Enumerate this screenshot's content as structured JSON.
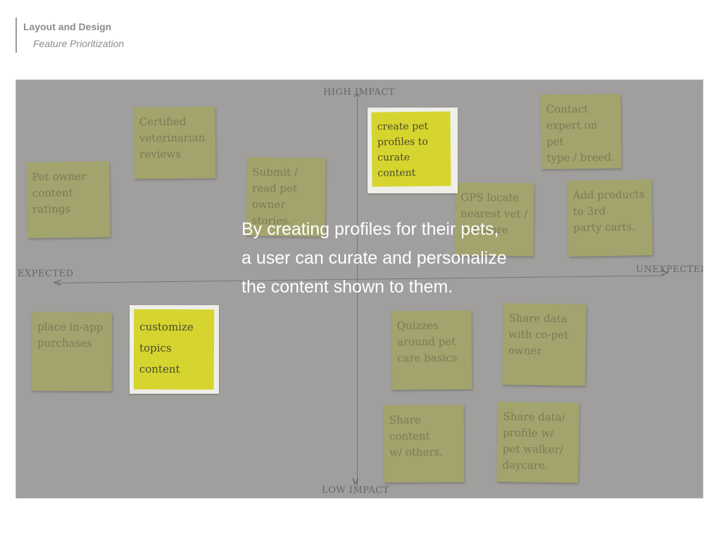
{
  "header": {
    "title": "Layout and Design",
    "subtitle": "Feature Prioritization"
  },
  "board": {
    "axes": {
      "top": "HIGH IMPACT",
      "bottom": "LOW IMPACT",
      "left": "EXPECTED",
      "right": "UNEXPECTED"
    },
    "notes": [
      {
        "lines": [
          "Certified",
          "veterinarian",
          "reviews"
        ]
      },
      {
        "lines": [
          "Pet owner",
          "content",
          "ratings"
        ]
      },
      {
        "lines": [
          "Submit /",
          "read pet",
          "owner",
          "stories."
        ]
      },
      {
        "lines": [
          "Contact",
          "expert on pet",
          "type / breed."
        ]
      },
      {
        "lines": [
          "GPS locate",
          "nearest vet /",
          "pet store"
        ]
      },
      {
        "lines": [
          "Add products",
          "to 3rd",
          "party carts."
        ]
      },
      {
        "lines": [
          "place in-app",
          "purchases"
        ]
      },
      {
        "lines": [
          "Quizzes",
          "around pet",
          "care basics"
        ]
      },
      {
        "lines": [
          "Share data",
          "with co-pet",
          "owner"
        ]
      },
      {
        "lines": [
          "Share content",
          "w/ others."
        ]
      },
      {
        "lines": [
          "Share data/",
          "profile w/",
          "pet walker/",
          "daycare."
        ]
      }
    ],
    "highlighted_notes": [
      {
        "lines": [
          "create pet",
          "profiles to",
          "curate",
          "content"
        ]
      },
      {
        "lines": [
          "customize",
          "topics",
          "content"
        ]
      }
    ]
  },
  "caption": {
    "lines": [
      "By creating profiles for their pets,",
      "a user can curate and personalize",
      "the content shown to them."
    ]
  }
}
